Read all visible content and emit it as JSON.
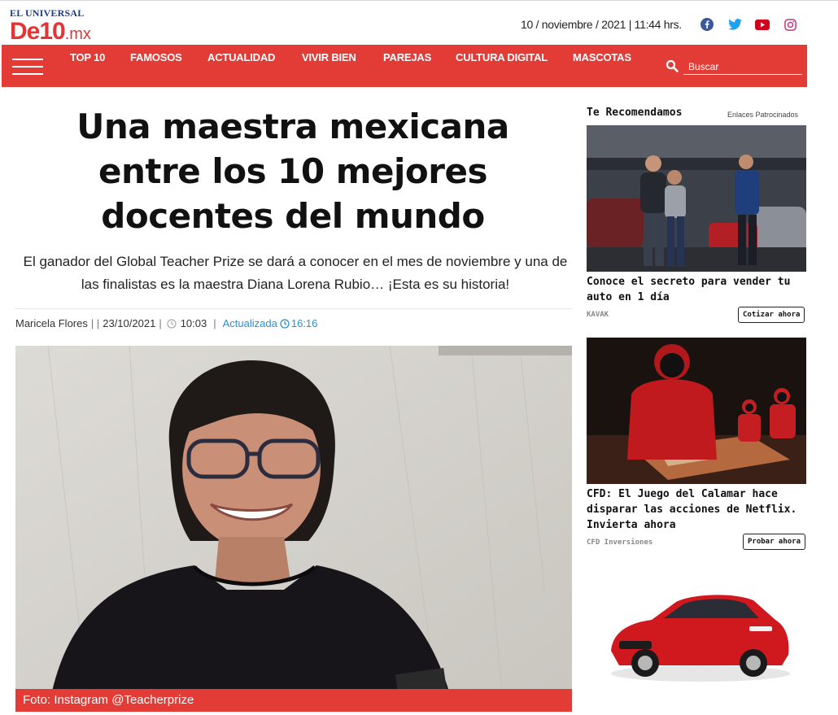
{
  "header": {
    "logo_top": "EL UNIVERSAL",
    "logo_main": "De10",
    "logo_suffix": ".mx",
    "date": "10 / noviembre / 2021 | 11:44 hrs.",
    "social": [
      "facebook-icon",
      "twitter-icon",
      "youtube-icon",
      "instagram-icon"
    ]
  },
  "nav": {
    "items": [
      "TOP 10",
      "FAMOSOS",
      "ACTUALIDAD",
      "VIVIR BIEN",
      "PAREJAS",
      "CULTURA DIGITAL",
      "MASCOTAS"
    ],
    "search_placeholder": "Buscar"
  },
  "article": {
    "headline": "Una maestra mexicana entre los 10 mejores docentes del mundo",
    "summary": "El ganador del Global Teacher Prize se dará a conocer en el mes de noviembre y una de las finalistas es la maestra Diana Lorena Rubio… ¡Esta es su historia!",
    "author": "Maricela Flores",
    "date": "23/10/2021",
    "time": "10:03",
    "updated_label": "Actualizada",
    "updated_time": "16:16",
    "photo_caption": "Foto: Instagram @Teacherprize"
  },
  "sidebar": {
    "title": "Te Recomendamos",
    "sponsored_label": "Enlaces Patrocinados",
    "ads": [
      {
        "title": "Conoce el secreto para vender tu auto en 1 día",
        "source": "KAVAK",
        "button": "Cotizar ahora"
      },
      {
        "title": "CFD: El Juego del Calamar hace disparar las acciones de Netflix. Invierta ahora",
        "source": "CFD Inversiones",
        "button": "Probar ahora"
      }
    ]
  },
  "colors": {
    "brand_red": "#e33b36",
    "logo_blue": "#1c3c8c",
    "link_blue": "#2a8fd0"
  }
}
